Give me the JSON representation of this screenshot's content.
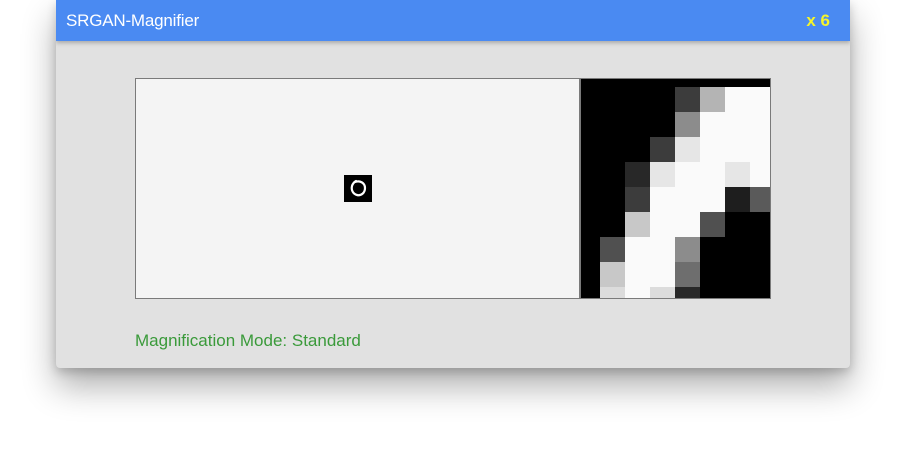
{
  "window": {
    "title": "SRGAN-Magnifier",
    "zoom_label": "x 6"
  },
  "viewer": {
    "thumbnail_glyph": "0",
    "zoom_grid": {
      "rows": 9,
      "cols": 8,
      "colors": [
        [
          "#000000",
          "#000000",
          "#000000",
          "#000000",
          "#3c3c3c",
          "#b4b4b4",
          "#fafafa",
          "#fafafa"
        ],
        [
          "#000000",
          "#000000",
          "#000000",
          "#000000",
          "#8c8c8c",
          "#fafafa",
          "#fafafa",
          "#fafafa"
        ],
        [
          "#000000",
          "#000000",
          "#000000",
          "#3c3c3c",
          "#e6e6e6",
          "#fafafa",
          "#fafafa",
          "#fafafa"
        ],
        [
          "#000000",
          "#000000",
          "#282828",
          "#e6e6e6",
          "#fafafa",
          "#fafafa",
          "#e6e6e6",
          "#fafafa"
        ],
        [
          "#000000",
          "#000000",
          "#3c3c3c",
          "#fafafa",
          "#fafafa",
          "#fafafa",
          "#1e1e1e",
          "#5a5a5a"
        ],
        [
          "#000000",
          "#000000",
          "#c8c8c8",
          "#fafafa",
          "#fafafa",
          "#505050",
          "#000000",
          "#000000"
        ],
        [
          "#000000",
          "#505050",
          "#fafafa",
          "#fafafa",
          "#8c8c8c",
          "#000000",
          "#000000",
          "#000000"
        ],
        [
          "#000000",
          "#c8c8c8",
          "#fafafa",
          "#fafafa",
          "#6e6e6e",
          "#000000",
          "#000000",
          "#000000"
        ],
        [
          "#000000",
          "#dcdcdc",
          "#fafafa",
          "#dcdcdc",
          "#282828",
          "#000000",
          "#000000",
          "#000000"
        ]
      ]
    }
  },
  "status": {
    "mode_text": "Magnification Mode: Standard"
  },
  "colors": {
    "titlebar": "#4a8af2",
    "zoom_label": "#f5f52a",
    "status_text": "#3a9a3a"
  }
}
